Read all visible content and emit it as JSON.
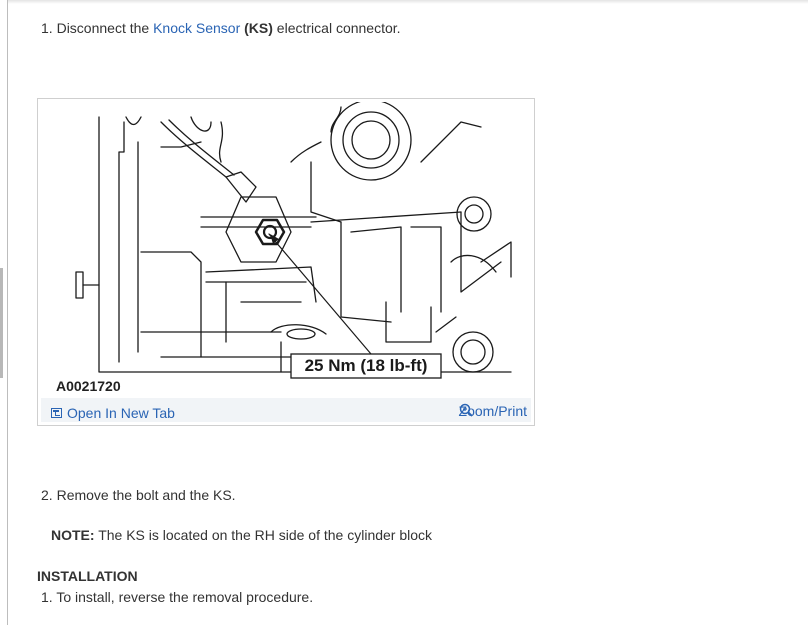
{
  "step1": {
    "number": "1.",
    "pre": " Disconnect the ",
    "link": "Knock Sensor",
    "abbr": "(KS)",
    "post": " electrical connector."
  },
  "figure": {
    "id": "A0021720",
    "torque_label": "25 Nm (18 lb-ft)",
    "open_tab_label": "Open In New Tab",
    "open_tab_icon": "open-in-new-tab-icon",
    "zoom_label": "Zoom/Print",
    "zoom_icon": "magnifier-plus-icon",
    "link_color": "#2a64b4"
  },
  "step2": {
    "number": "2.",
    "text": " Remove the bolt and the KS."
  },
  "note": {
    "label": "NOTE:",
    "text": " The KS is located on the RH side of the cylinder block"
  },
  "installation": {
    "heading": "INSTALLATION",
    "step1_number": "1.",
    "step1_text": " To install, reverse the removal procedure."
  }
}
